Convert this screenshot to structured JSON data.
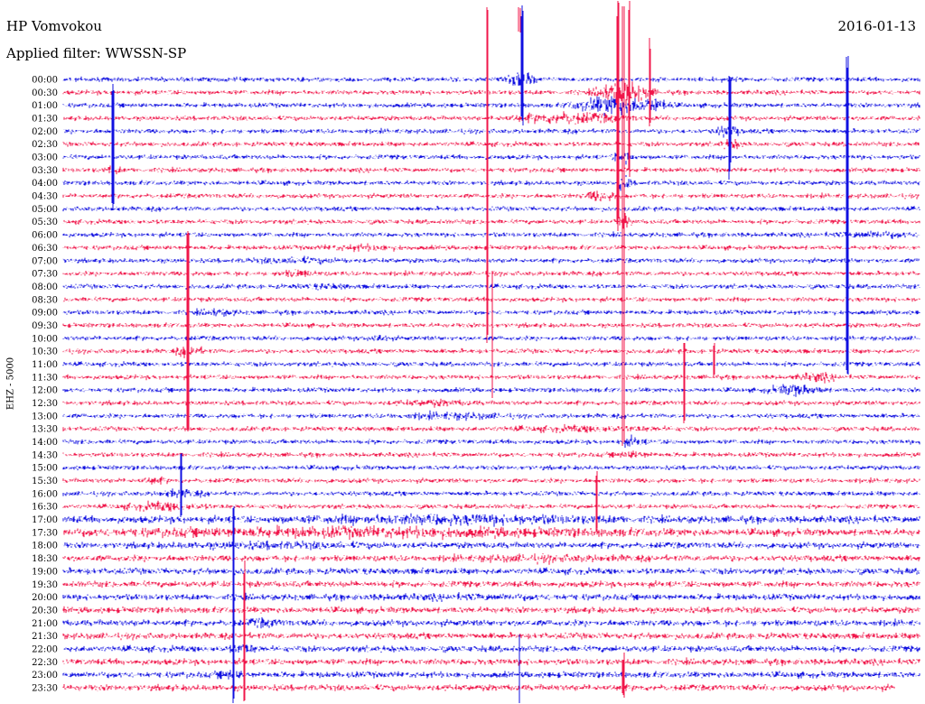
{
  "header": {
    "station": "HP Vomvokou",
    "filter": "Applied filter: WWSSN-SP",
    "date": "2016-01-13"
  },
  "chart_data": {
    "type": "line",
    "subtype": "helicorder",
    "ylabel": "EHZ - 5000",
    "row_labels": [
      "00:00",
      "00:30",
      "01:00",
      "01:30",
      "02:00",
      "02:30",
      "03:00",
      "03:30",
      "04:00",
      "04:30",
      "05:00",
      "05:30",
      "06:00",
      "06:30",
      "07:00",
      "07:30",
      "08:00",
      "08:30",
      "09:00",
      "09:30",
      "10:00",
      "10:30",
      "11:00",
      "11:30",
      "12:00",
      "12:30",
      "13:00",
      "13:30",
      "14:00",
      "14:30",
      "15:00",
      "15:30",
      "16:00",
      "16:30",
      "17:00",
      "17:30",
      "18:00",
      "18:30",
      "19:00",
      "19:30",
      "20:00",
      "20:30",
      "21:00",
      "21:30",
      "22:00",
      "22:30",
      "23:00",
      "23:30"
    ],
    "trace_colors": [
      "#1010e0",
      "#f0164a"
    ],
    "grid": false
  }
}
